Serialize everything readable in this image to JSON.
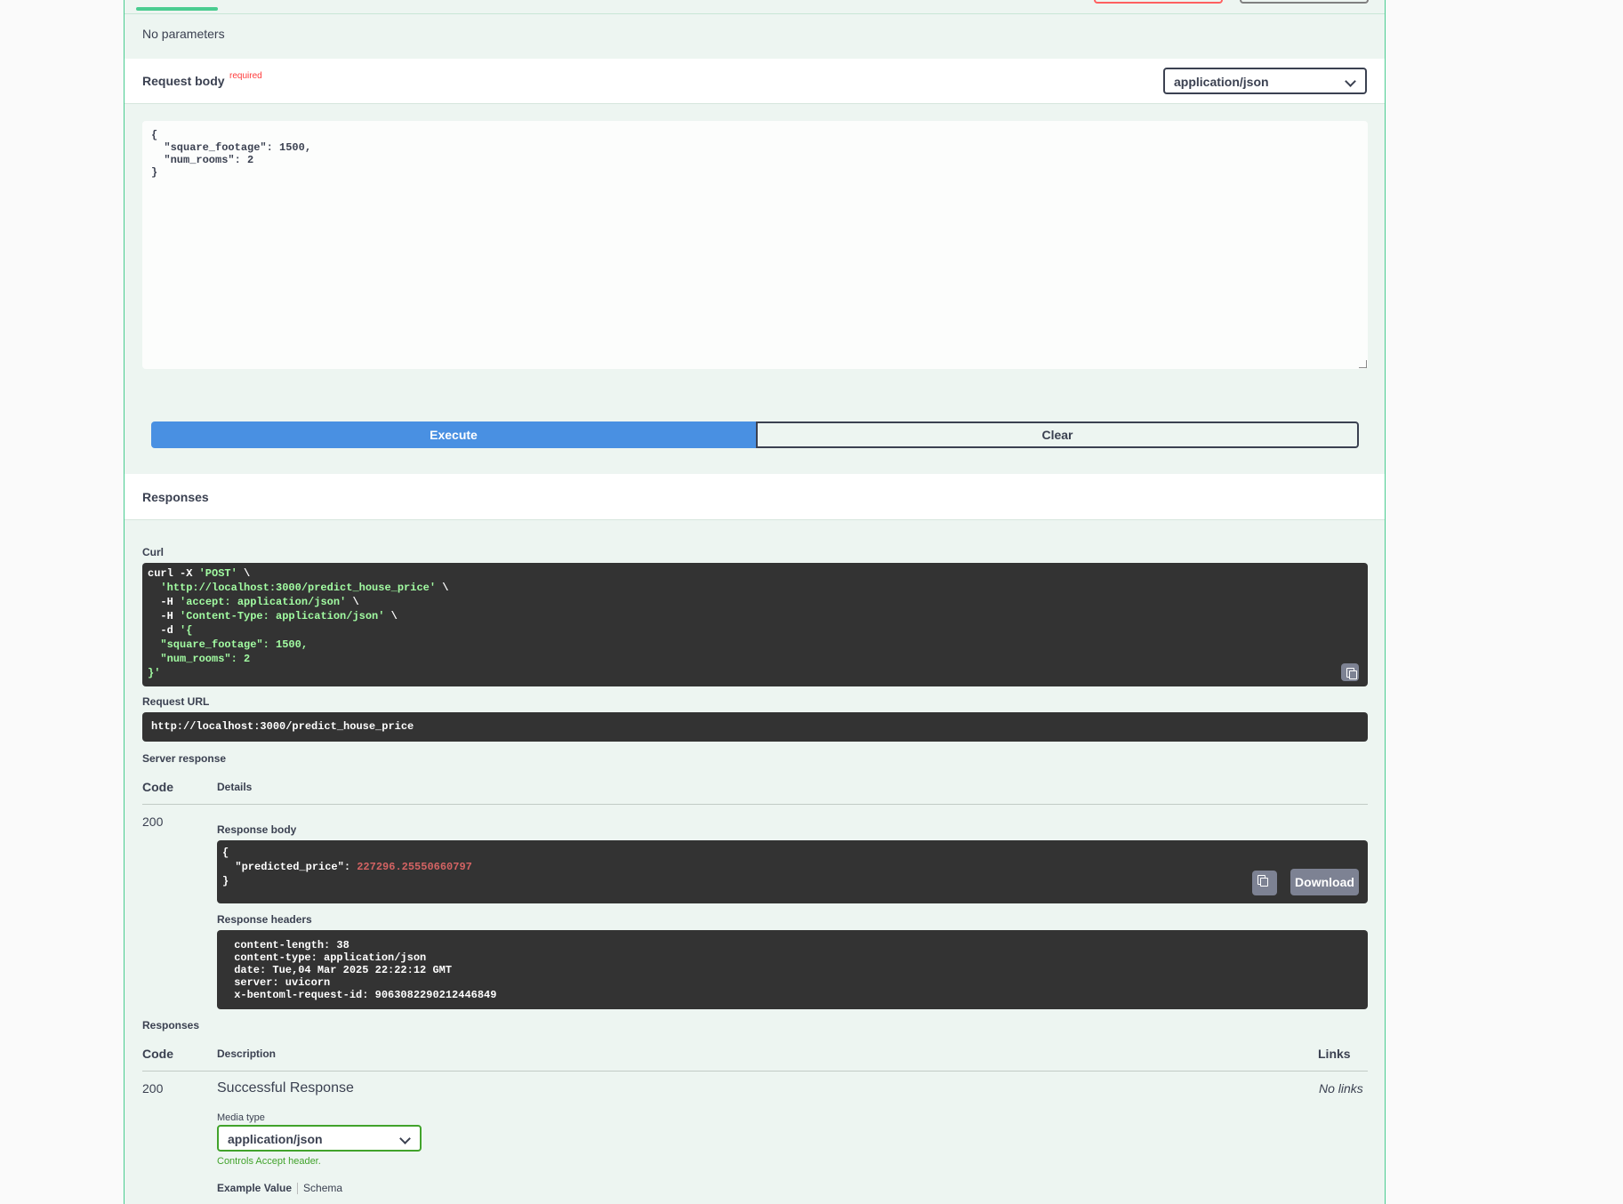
{
  "parameters": {
    "empty_text": "No parameters"
  },
  "request_body": {
    "title": "Request body",
    "required_label": "required",
    "content_type": "application/json",
    "value": "{\n  \"square_footage\": 1500,\n  \"num_rooms\": 2\n}"
  },
  "actions": {
    "execute_label": "Execute",
    "clear_label": "Clear"
  },
  "responses_section": {
    "title": "Responses"
  },
  "curl": {
    "label": "Curl",
    "line1_cmd": "curl -X ",
    "line1_str": "'POST'",
    "line1_end": " \\",
    "line2_str": "  'http://localhost:3000/predict_house_price'",
    "line2_end": " \\",
    "line3_cmd": "  -H ",
    "line3_str": "'accept: application/json'",
    "line3_end": " \\",
    "line4_cmd": "  -H ",
    "line4_str": "'Content-Type: application/json'",
    "line4_end": " \\",
    "line5_cmd": "  -d ",
    "line5_str": "'{",
    "line6_str": "  \"square_footage\": 1500,",
    "line7_str": "  \"num_rooms\": 2",
    "line8_str": "}'"
  },
  "request_url": {
    "label": "Request URL",
    "value": "http://localhost:3000/predict_house_price"
  },
  "server_response": {
    "label": "Server response",
    "col_code": "Code",
    "col_details": "Details",
    "code": "200",
    "body_label": "Response body",
    "body_open": "{",
    "body_key": "  \"predicted_price\": ",
    "body_value": "227296.25550660797",
    "body_close": "}",
    "download_label": "Download",
    "headers_label": "Response headers",
    "headers": " content-length: 38 \n content-type: application/json \n date: Tue,04 Mar 2025 22:22:12 GMT \n server: uvicorn \n x-bentoml-request-id: 9063082290212446849 "
  },
  "responses_table": {
    "label": "Responses",
    "col_code": "Code",
    "col_description": "Description",
    "col_links": "Links",
    "code": "200",
    "description": "Successful Response",
    "links": "No links",
    "media_type_label": "Media type",
    "media_type": "application/json",
    "accept_note": "Controls Accept header.",
    "tab_example": "Example Value",
    "tab_schema": "Schema"
  },
  "colors": {
    "accent_green": "#49cc90",
    "execute_blue": "#4990e2",
    "dark_block": "#333333"
  }
}
